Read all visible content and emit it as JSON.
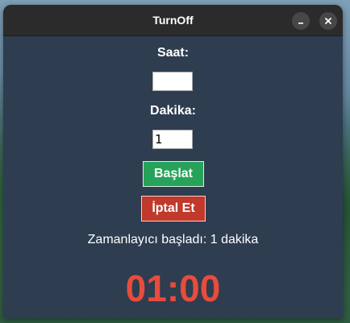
{
  "window": {
    "title": "TurnOff"
  },
  "form": {
    "hour_label": "Saat:",
    "hour_value": "",
    "minute_label": "Dakika:",
    "minute_value": "1"
  },
  "buttons": {
    "start_label": "Başlat",
    "cancel_label": "İptal Et"
  },
  "status": {
    "text": "Zamanlayıcı başladı: 1 dakika"
  },
  "timer": {
    "display": "01:00"
  },
  "icons": {
    "minimize": "minimize-icon",
    "close": "close-icon"
  },
  "colors": {
    "window_bg": "#2e3d50",
    "titlebar_bg": "#2b2b2b",
    "start_button": "#27a25a",
    "cancel_button": "#c0392b",
    "timer_text": "#e74c3c"
  }
}
